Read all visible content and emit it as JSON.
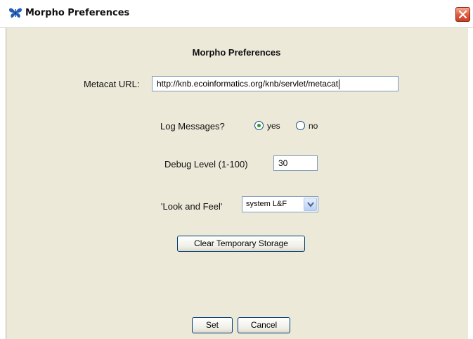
{
  "window": {
    "title": "Morpho Preferences",
    "icon": "butterfly-icon",
    "close_icon": "close-icon"
  },
  "dialog": {
    "heading": "Morpho Preferences",
    "metacat": {
      "label": "Metacat URL:",
      "value": "http://knb.ecoinformatics.org/knb/servlet/metacat"
    },
    "log_messages": {
      "label": "Log Messages?",
      "options": [
        "yes",
        "no"
      ],
      "selected": "yes"
    },
    "debug_level": {
      "label": "Debug Level (1-100)",
      "value": "30"
    },
    "look_and_feel": {
      "label": "'Look and Feel'",
      "selected": "system L&F"
    },
    "clear_storage_label": "Clear Temporary Storage",
    "set_label": "Set",
    "cancel_label": "Cancel"
  },
  "colors": {
    "background": "#ece9d8",
    "close_button": "#e0593a",
    "radio_selected": "#2c9b31",
    "button_border": "#003c74"
  }
}
